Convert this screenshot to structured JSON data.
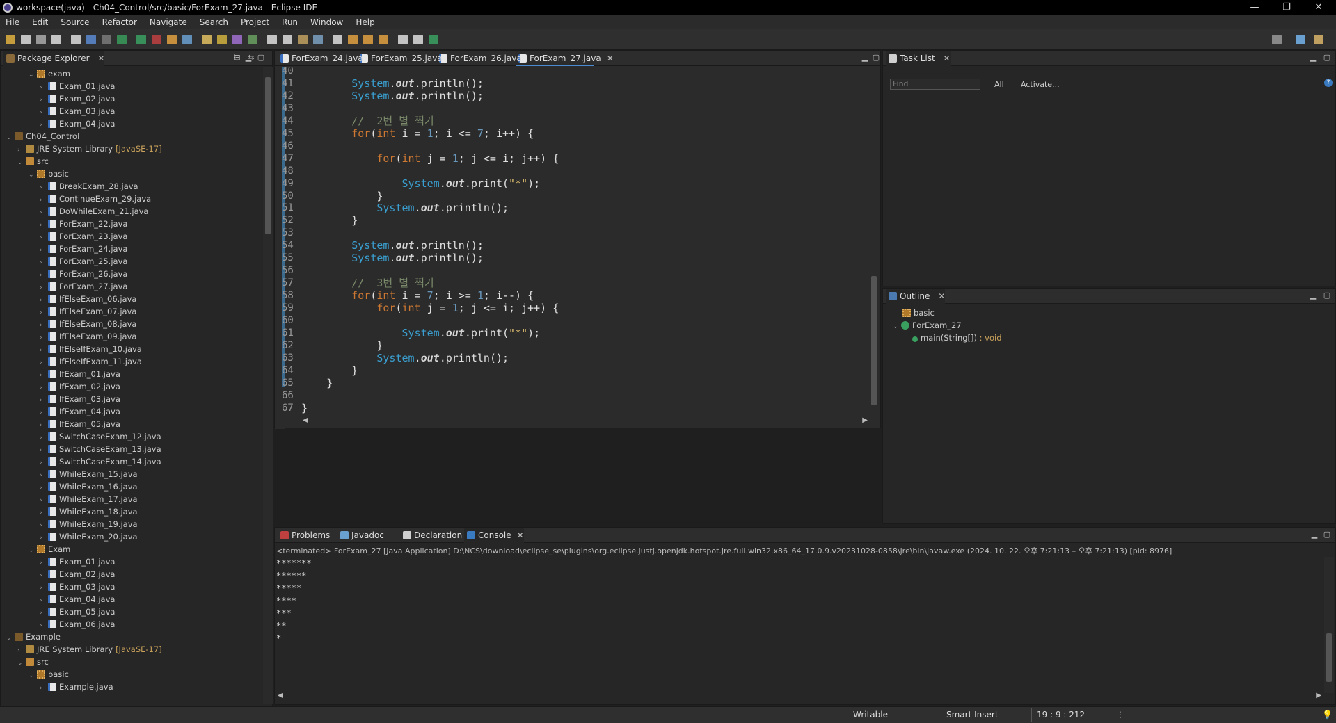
{
  "window": {
    "title": "workspace(java) - Ch04_Control/src/basic/ForExam_27.java - Eclipse IDE"
  },
  "menu": [
    "File",
    "Edit",
    "Source",
    "Refactor",
    "Navigate",
    "Search",
    "Project",
    "Run",
    "Window",
    "Help"
  ],
  "package_explorer": {
    "tab_label": "Package Explorer",
    "rows": [
      {
        "label": "exam",
        "type": "pkg",
        "indent": 2,
        "expand": "⌄"
      },
      {
        "label": "Exam_01.java",
        "type": "java",
        "indent": 3,
        "expand": "›"
      },
      {
        "label": "Exam_02.java",
        "type": "java",
        "indent": 3,
        "expand": "›"
      },
      {
        "label": "Exam_03.java",
        "type": "java",
        "indent": 3,
        "expand": "›"
      },
      {
        "label": "Exam_04.java",
        "type": "java",
        "indent": 3,
        "expand": "›"
      },
      {
        "label": "Ch04_Control",
        "type": "proj",
        "indent": 0,
        "expand": "⌄"
      },
      {
        "label": "JRE System Library",
        "suffix": "[JavaSE-17]",
        "type": "lib",
        "indent": 1,
        "expand": "›"
      },
      {
        "label": "src",
        "type": "folder",
        "indent": 1,
        "expand": "⌄"
      },
      {
        "label": "basic",
        "type": "pkg",
        "indent": 2,
        "expand": "⌄"
      },
      {
        "label": "BreakExam_28.java",
        "type": "java",
        "indent": 3,
        "expand": "›"
      },
      {
        "label": "ContinueExam_29.java",
        "type": "java",
        "indent": 3,
        "expand": "›"
      },
      {
        "label": "DoWhileExam_21.java",
        "type": "java",
        "indent": 3,
        "expand": "›"
      },
      {
        "label": "ForExam_22.java",
        "type": "java",
        "indent": 3,
        "expand": "›"
      },
      {
        "label": "ForExam_23.java",
        "type": "java",
        "indent": 3,
        "expand": "›"
      },
      {
        "label": "ForExam_24.java",
        "type": "java",
        "indent": 3,
        "expand": "›"
      },
      {
        "label": "ForExam_25.java",
        "type": "java",
        "indent": 3,
        "expand": "›"
      },
      {
        "label": "ForExam_26.java",
        "type": "java",
        "indent": 3,
        "expand": "›"
      },
      {
        "label": "ForExam_27.java",
        "type": "java",
        "indent": 3,
        "expand": "›"
      },
      {
        "label": "IfElseExam_06.java",
        "type": "java",
        "indent": 3,
        "expand": "›"
      },
      {
        "label": "IfElseExam_07.java",
        "type": "java",
        "indent": 3,
        "expand": "›"
      },
      {
        "label": "IfElseExam_08.java",
        "type": "java",
        "indent": 3,
        "expand": "›"
      },
      {
        "label": "IfElseExam_09.java",
        "type": "java",
        "indent": 3,
        "expand": "›"
      },
      {
        "label": "IfElseIfExam_10.java",
        "type": "java",
        "indent": 3,
        "expand": "›"
      },
      {
        "label": "IfElseIfExam_11.java",
        "type": "java",
        "indent": 3,
        "expand": "›"
      },
      {
        "label": "IfExam_01.java",
        "type": "java",
        "indent": 3,
        "expand": "›"
      },
      {
        "label": "IfExam_02.java",
        "type": "java",
        "indent": 3,
        "expand": "›"
      },
      {
        "label": "IfExam_03.java",
        "type": "java",
        "indent": 3,
        "expand": "›"
      },
      {
        "label": "IfExam_04.java",
        "type": "java",
        "indent": 3,
        "expand": "›"
      },
      {
        "label": "IfExam_05.java",
        "type": "java",
        "indent": 3,
        "expand": "›"
      },
      {
        "label": "SwitchCaseExam_12.java",
        "type": "java",
        "indent": 3,
        "expand": "›"
      },
      {
        "label": "SwitchCaseExam_13.java",
        "type": "java",
        "indent": 3,
        "expand": "›"
      },
      {
        "label": "SwitchCaseExam_14.java",
        "type": "java",
        "indent": 3,
        "expand": "›"
      },
      {
        "label": "WhileExam_15.java",
        "type": "java",
        "indent": 3,
        "expand": "›"
      },
      {
        "label": "WhileExam_16.java",
        "type": "java",
        "indent": 3,
        "expand": "›"
      },
      {
        "label": "WhileExam_17.java",
        "type": "java",
        "indent": 3,
        "expand": "›"
      },
      {
        "label": "WhileExam_18.java",
        "type": "java",
        "indent": 3,
        "expand": "›"
      },
      {
        "label": "WhileExam_19.java",
        "type": "java",
        "indent": 3,
        "expand": "›"
      },
      {
        "label": "WhileExam_20.java",
        "type": "java",
        "indent": 3,
        "expand": "›"
      },
      {
        "label": "Exam",
        "type": "pkg",
        "indent": 2,
        "expand": "⌄"
      },
      {
        "label": "Exam_01.java",
        "type": "java",
        "indent": 3,
        "expand": "›"
      },
      {
        "label": "Exam_02.java",
        "type": "java",
        "indent": 3,
        "expand": "›"
      },
      {
        "label": "Exam_03.java",
        "type": "java",
        "indent": 3,
        "expand": "›"
      },
      {
        "label": "Exam_04.java",
        "type": "java",
        "indent": 3,
        "expand": "›"
      },
      {
        "label": "Exam_05.java",
        "type": "java",
        "indent": 3,
        "expand": "›"
      },
      {
        "label": "Exam_06.java",
        "type": "java",
        "indent": 3,
        "expand": "›"
      },
      {
        "label": "Example",
        "type": "proj",
        "indent": 0,
        "expand": "⌄"
      },
      {
        "label": "JRE System Library",
        "suffix": "[JavaSE-17]",
        "type": "lib",
        "indent": 1,
        "expand": "›"
      },
      {
        "label": "src",
        "type": "folder",
        "indent": 1,
        "expand": "⌄"
      },
      {
        "label": "basic",
        "type": "pkg",
        "indent": 2,
        "expand": "⌄"
      },
      {
        "label": "Example.java",
        "type": "java",
        "indent": 3,
        "expand": "›"
      }
    ]
  },
  "editor": {
    "tabs": [
      {
        "label": "ForExam_24.java",
        "active": false
      },
      {
        "label": "ForExam_25.java",
        "active": false
      },
      {
        "label": "ForExam_26.java",
        "active": false
      },
      {
        "label": "ForExam_27.java",
        "active": true
      }
    ],
    "lines": [
      {
        "n": "40",
        "tokens": []
      },
      {
        "n": "41",
        "tokens": [
          [
            "plain",
            "        "
          ],
          [
            "sys",
            "System"
          ],
          [
            "plain",
            "."
          ],
          [
            "out",
            "out"
          ],
          [
            "plain",
            "."
          ],
          [
            "meth",
            "println"
          ],
          [
            "plain",
            "();"
          ]
        ]
      },
      {
        "n": "42",
        "tokens": [
          [
            "plain",
            "        "
          ],
          [
            "sys",
            "System"
          ],
          [
            "plain",
            "."
          ],
          [
            "out",
            "out"
          ],
          [
            "plain",
            "."
          ],
          [
            "meth",
            "println"
          ],
          [
            "plain",
            "();"
          ]
        ]
      },
      {
        "n": "43",
        "tokens": []
      },
      {
        "n": "44",
        "tokens": [
          [
            "plain",
            "        "
          ],
          [
            "cmt",
            "//  2번 별 찍기"
          ]
        ]
      },
      {
        "n": "45",
        "tokens": [
          [
            "plain",
            "        "
          ],
          [
            "kw",
            "for"
          ],
          [
            "plain",
            "("
          ],
          [
            "kw",
            "int"
          ],
          [
            "plain",
            " i = "
          ],
          [
            "num",
            "1"
          ],
          [
            "plain",
            "; i <= "
          ],
          [
            "num",
            "7"
          ],
          [
            "plain",
            "; i++) {"
          ]
        ]
      },
      {
        "n": "46",
        "tokens": []
      },
      {
        "n": "47",
        "tokens": [
          [
            "plain",
            "            "
          ],
          [
            "kw",
            "for"
          ],
          [
            "plain",
            "("
          ],
          [
            "kw",
            "int"
          ],
          [
            "plain",
            " j = "
          ],
          [
            "num",
            "1"
          ],
          [
            "plain",
            "; j <= i; j++) {"
          ]
        ]
      },
      {
        "n": "48",
        "tokens": []
      },
      {
        "n": "49",
        "tokens": [
          [
            "plain",
            "                "
          ],
          [
            "sys",
            "System"
          ],
          [
            "plain",
            "."
          ],
          [
            "out",
            "out"
          ],
          [
            "plain",
            "."
          ],
          [
            "meth",
            "print"
          ],
          [
            "plain",
            "("
          ],
          [
            "str",
            "\"*\""
          ],
          [
            "plain",
            ");"
          ]
        ]
      },
      {
        "n": "50",
        "tokens": [
          [
            "plain",
            "            }"
          ]
        ]
      },
      {
        "n": "51",
        "tokens": [
          [
            "plain",
            "            "
          ],
          [
            "sys",
            "System"
          ],
          [
            "plain",
            "."
          ],
          [
            "out",
            "out"
          ],
          [
            "plain",
            "."
          ],
          [
            "meth",
            "println"
          ],
          [
            "plain",
            "();"
          ]
        ]
      },
      {
        "n": "52",
        "tokens": [
          [
            "plain",
            "        }"
          ]
        ]
      },
      {
        "n": "53",
        "tokens": []
      },
      {
        "n": "54",
        "tokens": [
          [
            "plain",
            "        "
          ],
          [
            "sys",
            "System"
          ],
          [
            "plain",
            "."
          ],
          [
            "out",
            "out"
          ],
          [
            "plain",
            "."
          ],
          [
            "meth",
            "println"
          ],
          [
            "plain",
            "();"
          ]
        ]
      },
      {
        "n": "55",
        "tokens": [
          [
            "plain",
            "        "
          ],
          [
            "sys",
            "System"
          ],
          [
            "plain",
            "."
          ],
          [
            "out",
            "out"
          ],
          [
            "plain",
            "."
          ],
          [
            "meth",
            "println"
          ],
          [
            "plain",
            "();"
          ]
        ]
      },
      {
        "n": "56",
        "tokens": []
      },
      {
        "n": "57",
        "tokens": [
          [
            "plain",
            "        "
          ],
          [
            "cmt",
            "//  3번 별 찍기"
          ]
        ]
      },
      {
        "n": "58",
        "tokens": [
          [
            "plain",
            "        "
          ],
          [
            "kw",
            "for"
          ],
          [
            "plain",
            "("
          ],
          [
            "kw",
            "int"
          ],
          [
            "plain",
            " i = "
          ],
          [
            "num",
            "7"
          ],
          [
            "plain",
            "; i >= "
          ],
          [
            "num",
            "1"
          ],
          [
            "plain",
            "; i--) {"
          ]
        ]
      },
      {
        "n": "59",
        "tokens": [
          [
            "plain",
            "            "
          ],
          [
            "kw",
            "for"
          ],
          [
            "plain",
            "("
          ],
          [
            "kw",
            "int"
          ],
          [
            "plain",
            " j = "
          ],
          [
            "num",
            "1"
          ],
          [
            "plain",
            "; j <= i; j++) {"
          ]
        ]
      },
      {
        "n": "60",
        "tokens": []
      },
      {
        "n": "61",
        "tokens": [
          [
            "plain",
            "                "
          ],
          [
            "sys",
            "System"
          ],
          [
            "plain",
            "."
          ],
          [
            "out",
            "out"
          ],
          [
            "plain",
            "."
          ],
          [
            "meth",
            "print"
          ],
          [
            "plain",
            "("
          ],
          [
            "str",
            "\"*\""
          ],
          [
            "plain",
            ");"
          ]
        ]
      },
      {
        "n": "62",
        "tokens": [
          [
            "plain",
            "            }"
          ]
        ]
      },
      {
        "n": "63",
        "tokens": [
          [
            "plain",
            "            "
          ],
          [
            "sys",
            "System"
          ],
          [
            "plain",
            "."
          ],
          [
            "out",
            "out"
          ],
          [
            "plain",
            "."
          ],
          [
            "meth",
            "println"
          ],
          [
            "plain",
            "();"
          ]
        ]
      },
      {
        "n": "64",
        "tokens": [
          [
            "plain",
            "        }"
          ]
        ]
      },
      {
        "n": "65",
        "tokens": [
          [
            "plain",
            "    }"
          ]
        ]
      },
      {
        "n": "66",
        "tokens": []
      },
      {
        "n": "67",
        "tokens": [
          [
            "plain",
            "}"
          ]
        ]
      },
      {
        "n": "68",
        "tokens": []
      }
    ]
  },
  "task_list": {
    "tab_label": "Task List",
    "find_placeholder": "Find",
    "all_label": "All",
    "activate_label": "Activate..."
  },
  "outline": {
    "tab_label": "Outline",
    "package": "basic",
    "class": "ForExam_27",
    "method": "main(String[])",
    "method_type": ": void"
  },
  "console": {
    "tabs": [
      "Problems",
      "Javadoc",
      "Declaration",
      "Console"
    ],
    "header": "<terminated> ForExam_27 [Java Application] D:\\NCS\\download\\eclipse_se\\plugins\\org.eclipse.justj.openjdk.hotspot.jre.full.win32.x86_64_17.0.9.v20231028-0858\\jre\\bin\\javaw.exe  (2024. 10. 22. 오후 7:21:13 – 오후 7:21:13) [pid: 8976]",
    "output": "*******\n******\n*****\n****\n***\n**\n*"
  },
  "status": {
    "writable": "Writable",
    "insert": "Smart Insert",
    "position": "19 : 9 : 212"
  }
}
